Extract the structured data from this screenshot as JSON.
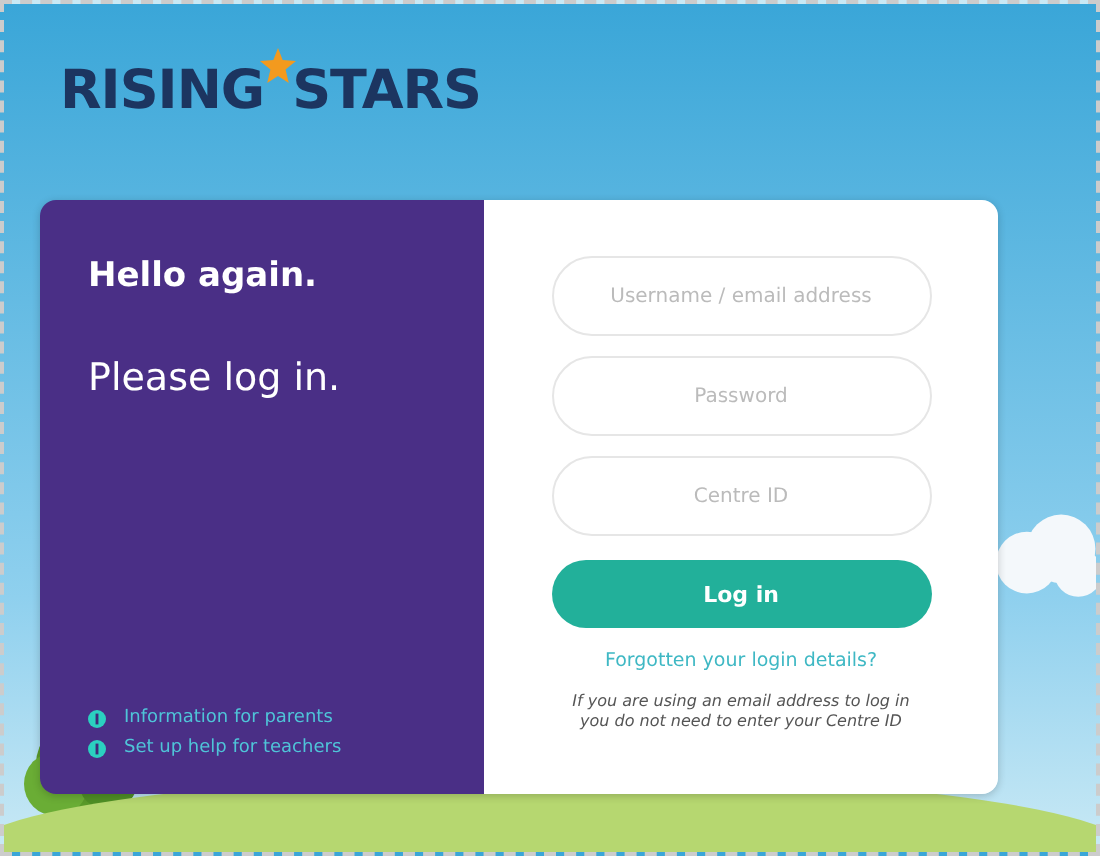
{
  "logo": {
    "word_1": "RISING",
    "word_2": "STARS"
  },
  "welcome": {
    "greeting": "Hello again.",
    "prompt": "Please log in.",
    "links": [
      {
        "label": "Information for parents"
      },
      {
        "label": "Set up help for teachers"
      }
    ]
  },
  "form": {
    "fields": [
      {
        "placeholder": "Username / email address"
      },
      {
        "placeholder": "Password"
      },
      {
        "placeholder": "Centre ID"
      }
    ],
    "submit": "Log in",
    "forgot_link": "Forgotten your login details?",
    "note": "If you are using an email address to log in you do not need to enter your Centre ID"
  }
}
